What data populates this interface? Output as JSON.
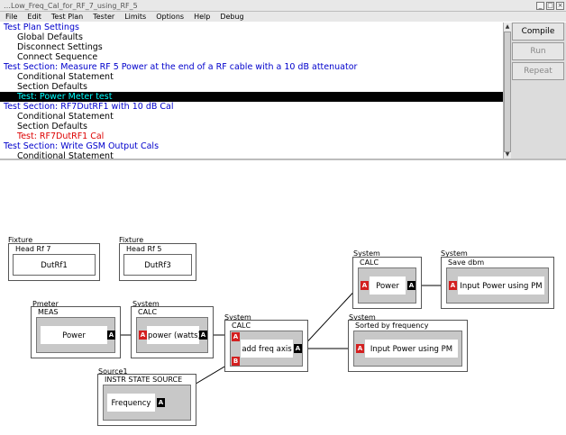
{
  "window": {
    "title": "…Low_Freq_Cal_for_RF_7_using_RF_5",
    "buttons": [
      "_",
      "□",
      "×"
    ]
  },
  "menu": [
    "File",
    "Edit",
    "Test Plan",
    "Tester",
    "Limits",
    "Options",
    "Help",
    "Debug"
  ],
  "tree": [
    {
      "text": "Test Plan Settings",
      "level": 0
    },
    {
      "text": "Global Defaults",
      "level": 1
    },
    {
      "text": "Disconnect Settings",
      "level": 1
    },
    {
      "text": "Connect Sequence",
      "level": 1
    },
    {
      "text": "Test Section: Measure RF 5 Power at the end of a RF cable with a 10 dB attenuator",
      "level": 0
    },
    {
      "text": "Conditional Statement",
      "level": 1
    },
    {
      "text": "Section Defaults",
      "level": 1
    },
    {
      "text": "Test: Power Meter test",
      "level": 1,
      "selected": true
    },
    {
      "text": "Test Section: RF7DutRF1 with 10 dB Cal",
      "level": 0
    },
    {
      "text": "Conditional Statement",
      "level": 1
    },
    {
      "text": "Section Defaults",
      "level": 1
    },
    {
      "text": "Test: RF7DutRF1 Cal",
      "level": 1,
      "red": true
    },
    {
      "text": "Test Section: Write GSM Output Cals",
      "level": 0
    },
    {
      "text": "Conditional Statement",
      "level": 1
    }
  ],
  "buttons": {
    "compile": "Compile",
    "run": "Run",
    "repeat": "Repeat"
  },
  "diagram": {
    "fixture1": {
      "category": "Fixture",
      "label": "Head Rf 7",
      "content": "DutRf1"
    },
    "fixture2": {
      "category": "Fixture",
      "label": "Head Rf 5",
      "content": "DutRf3"
    },
    "pmeter": {
      "category": "Pmeter",
      "label": "MEAS",
      "content": "Power",
      "port_out": "A"
    },
    "calc1": {
      "category": "System",
      "label": "CALC",
      "content": "power (watts)",
      "port_in": "A",
      "port_out": "A"
    },
    "calc2": {
      "category": "System",
      "label": "CALC",
      "content": "add freq axis",
      "port_in_a": "A",
      "port_in_b": "B",
      "port_out": "A"
    },
    "source": {
      "category": "Source1",
      "label": "INSTR STATE SOURCE",
      "content": "Frequency",
      "port_out": "A"
    },
    "calc3": {
      "category": "System",
      "label": "CALC",
      "content": "Power",
      "port_in": "A",
      "port_out": "A"
    },
    "savedbm": {
      "category": "System",
      "label": "Save dbm",
      "content": "Input Power using PM",
      "port_in": "A"
    },
    "sorted": {
      "category": "System",
      "label": "Sorted by frequency",
      "content": "Input Power using PM",
      "port_in": "A"
    }
  },
  "colors": {
    "section": "#0000cc",
    "selected_bg": "#000000",
    "selected_fg": "#00ffff",
    "error": "#dd0000",
    "port_in": "#d32020",
    "port_out": "#000000"
  }
}
